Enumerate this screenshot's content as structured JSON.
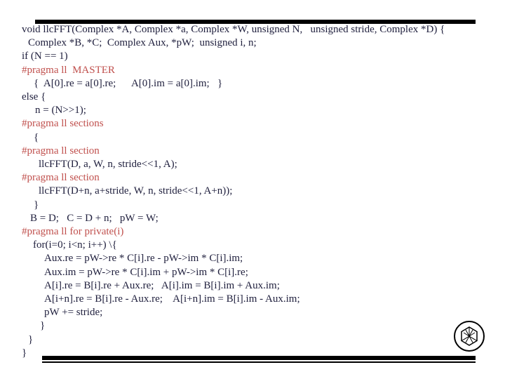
{
  "code": {
    "lines": [
      {
        "text": "void llcFFT(Complex *A, Complex *a, Complex *W, unsigned N,   unsigned stride, Complex *D) {",
        "indent": 0,
        "pragma": false
      },
      {
        "text": "Complex *B, *C;  Complex Aux, *pW;  unsigned i, n;",
        "indent": 9,
        "pragma": false
      },
      {
        "text": "if (N == 1)",
        "indent": 0,
        "pragma": false
      },
      {
        "text": "#pragma ll  MASTER",
        "indent": 0,
        "pragma": true
      },
      {
        "text": "{  A[0].re = a[0].re;      A[0].im = a[0].im;   }",
        "indent": 17,
        "pragma": false
      },
      {
        "text": "else {",
        "indent": 0,
        "pragma": false
      },
      {
        "text": "n = (N>>1);",
        "indent": 19,
        "pragma": false
      },
      {
        "text": "#pragma ll sections",
        "indent": 0,
        "pragma": true
      },
      {
        "text": "{",
        "indent": 17,
        "pragma": false
      },
      {
        "text": "#pragma ll section",
        "indent": 0,
        "pragma": true
      },
      {
        "text": "llcFFT(D, a, W, n, stride<<1, A);",
        "indent": 24,
        "pragma": false
      },
      {
        "text": "#pragma ll section",
        "indent": 0,
        "pragma": true
      },
      {
        "text": "llcFFT(D+n, a+stride, W, n, stride<<1, A+n));",
        "indent": 24,
        "pragma": false
      },
      {
        "text": "}",
        "indent": 17,
        "pragma": false
      },
      {
        "text": "B = D;   C = D + n;   pW = W;",
        "indent": 12,
        "pragma": false
      },
      {
        "text": "#pragma ll for private(i)",
        "indent": 0,
        "pragma": true
      },
      {
        "text": "for(i=0; i<n; i++) \\{",
        "indent": 16,
        "pragma": false
      },
      {
        "text": "Aux.re = pW->re * C[i].re - pW->im * C[i].im;",
        "indent": 32,
        "pragma": false
      },
      {
        "text": "Aux.im = pW->re * C[i].im + pW->im * C[i].re;",
        "indent": 32,
        "pragma": false
      },
      {
        "text": "A[i].re = B[i].re + Aux.re;   A[i].im = B[i].im + Aux.im;",
        "indent": 32,
        "pragma": false
      },
      {
        "text": "A[i+n].re = B[i].re - Aux.re;    A[i+n].im = B[i].im - Aux.im;",
        "indent": 32,
        "pragma": false
      },
      {
        "text": "pW += stride;",
        "indent": 32,
        "pragma": false
      },
      {
        "text": "}",
        "indent": 26,
        "pragma": false
      },
      {
        "text": "}",
        "indent": 9,
        "pragma": false
      },
      {
        "text": "}",
        "indent": 0,
        "pragma": false
      }
    ]
  },
  "colors": {
    "code": "#1f1f3d",
    "pragma": "#c0504d"
  },
  "logo": {
    "icon": "institution-seal-icon"
  }
}
